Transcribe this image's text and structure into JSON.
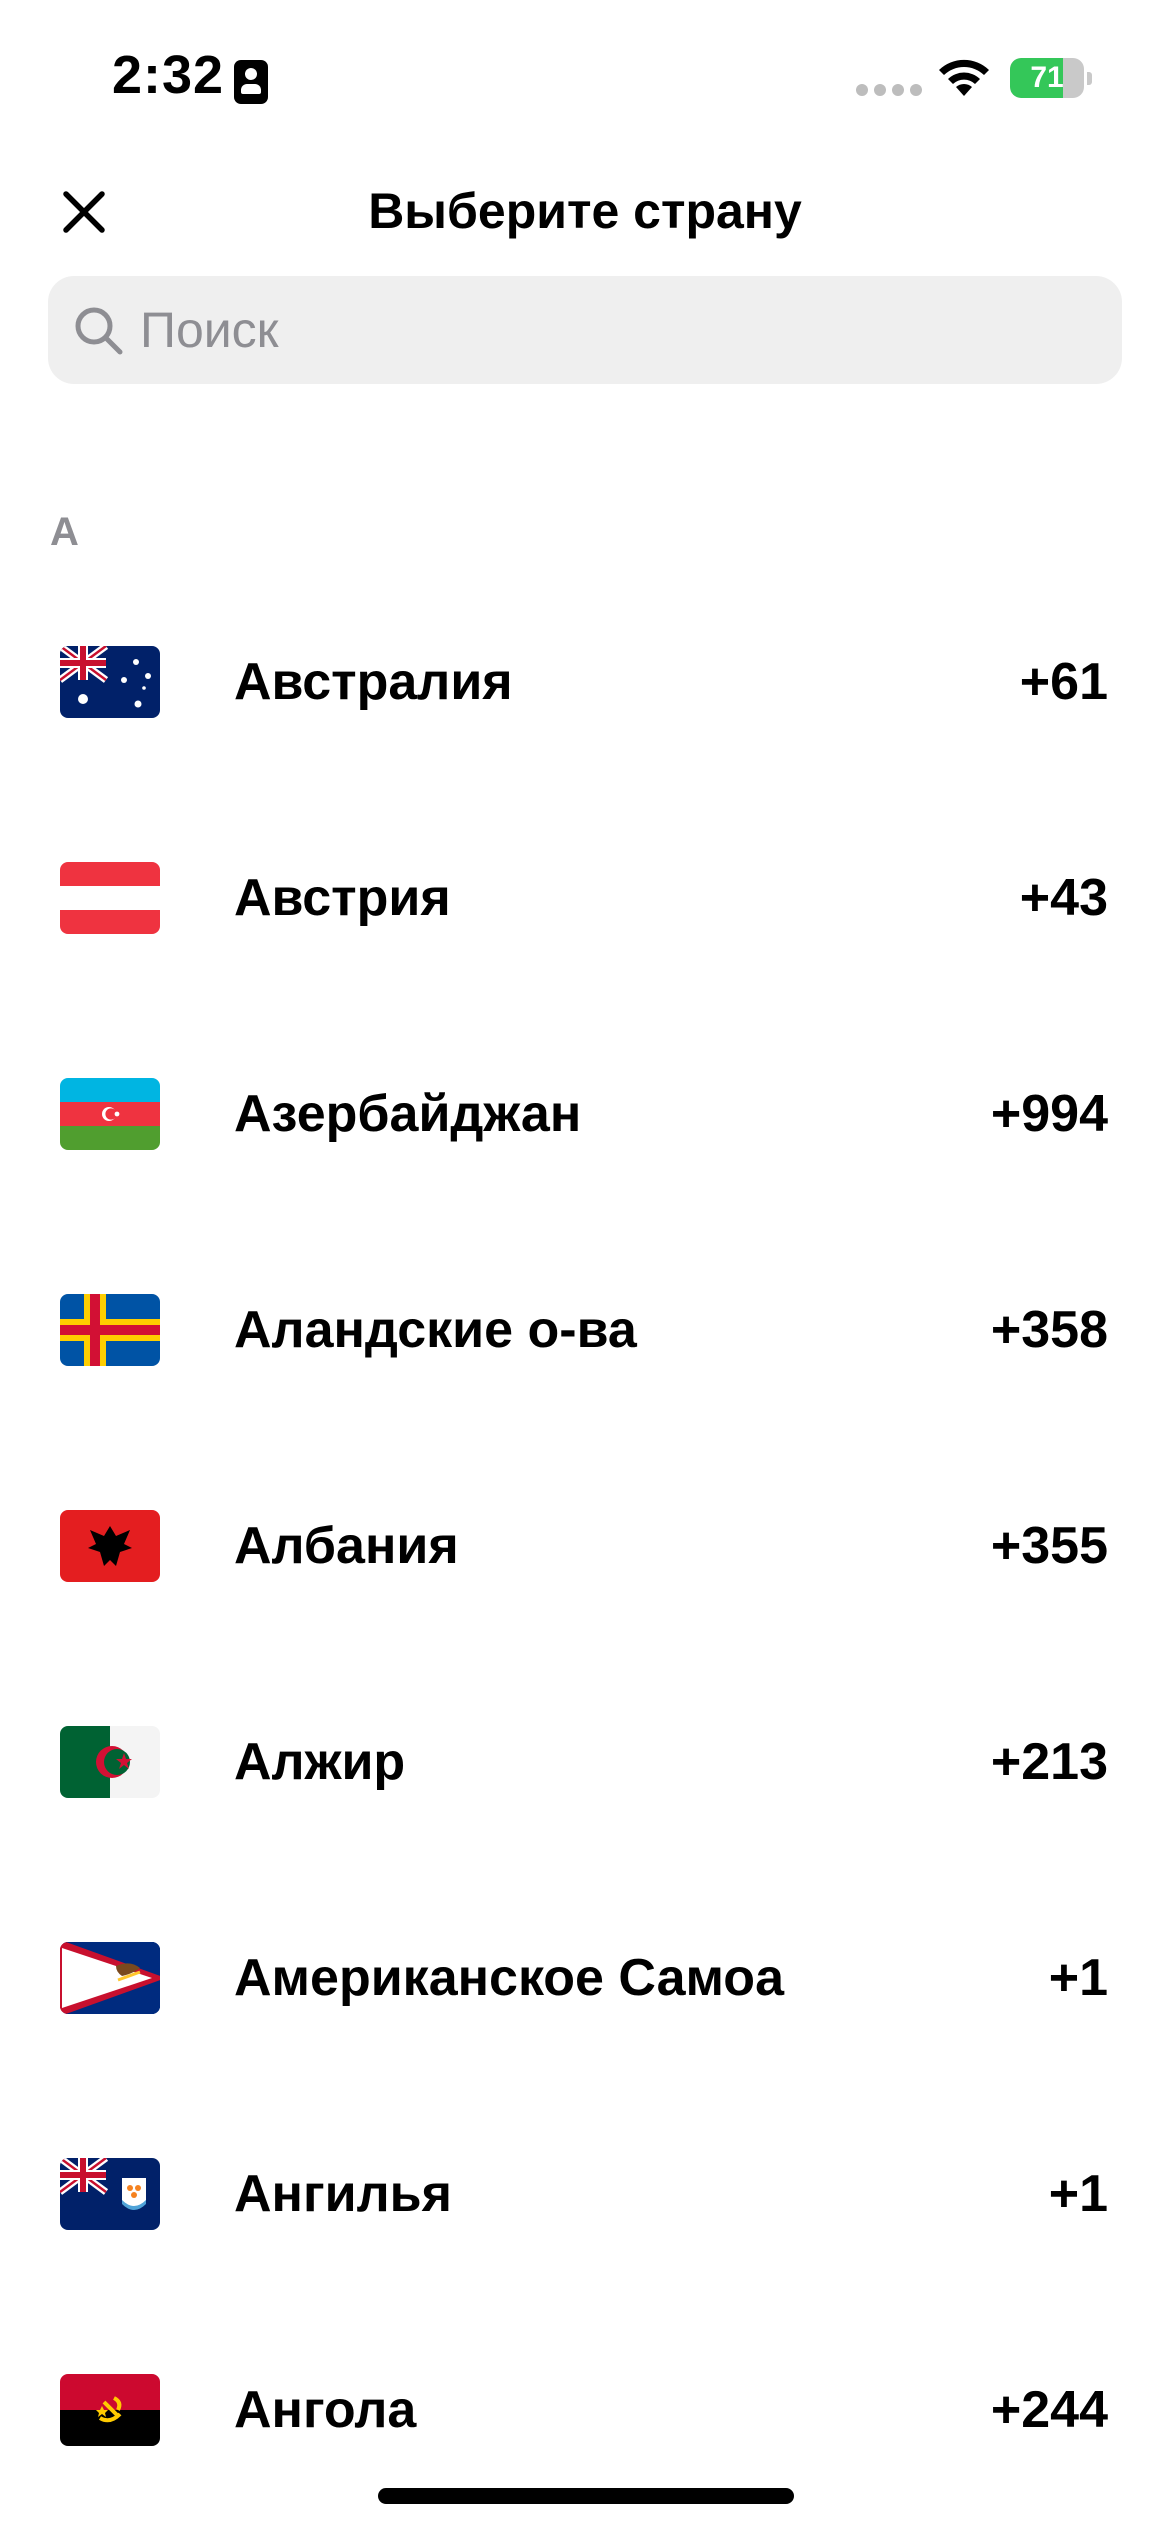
{
  "status_bar": {
    "time": "2:32",
    "battery_level": "71",
    "battery_percent": 71,
    "battery_color": "#34c759"
  },
  "header": {
    "title": "Выберите страну",
    "close_icon": "close-icon"
  },
  "search": {
    "placeholder": "Поиск",
    "value": "",
    "icon": "search-icon"
  },
  "section": {
    "letter": "А"
  },
  "countries": [
    {
      "name": "Австралия",
      "code": "+61",
      "flag": "australia-flag-icon"
    },
    {
      "name": "Австрия",
      "code": "+43",
      "flag": "austria-flag-icon"
    },
    {
      "name": "Азербайджан",
      "code": "+994",
      "flag": "azerbaijan-flag-icon"
    },
    {
      "name": "Аландские о-ва",
      "code": "+358",
      "flag": "aland-flag-icon"
    },
    {
      "name": "Албания",
      "code": "+355",
      "flag": "albania-flag-icon"
    },
    {
      "name": "Алжир",
      "code": "+213",
      "flag": "algeria-flag-icon"
    },
    {
      "name": "Американское Самоа",
      "code": "+1",
      "flag": "american-samoa-flag-icon"
    },
    {
      "name": "Ангилья",
      "code": "+1",
      "flag": "anguilla-flag-icon"
    },
    {
      "name": "Ангола",
      "code": "+244",
      "flag": "angola-flag-icon"
    }
  ]
}
